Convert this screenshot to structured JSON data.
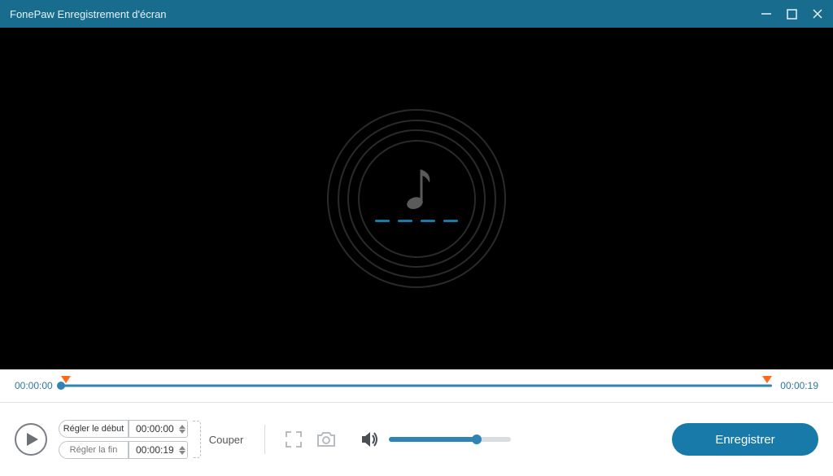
{
  "window": {
    "title": "FonePaw Enregistrement d'écran"
  },
  "timeline": {
    "start": "00:00:00",
    "end": "00:00:19"
  },
  "clip": {
    "start_label": "Régler le début",
    "start_value": "00:00:00",
    "end_label": "Régler la fin",
    "end_value": "00:00:19",
    "cut_label": "Couper"
  },
  "volume": {
    "percent": 72
  },
  "actions": {
    "save_label": "Enregistrer"
  }
}
